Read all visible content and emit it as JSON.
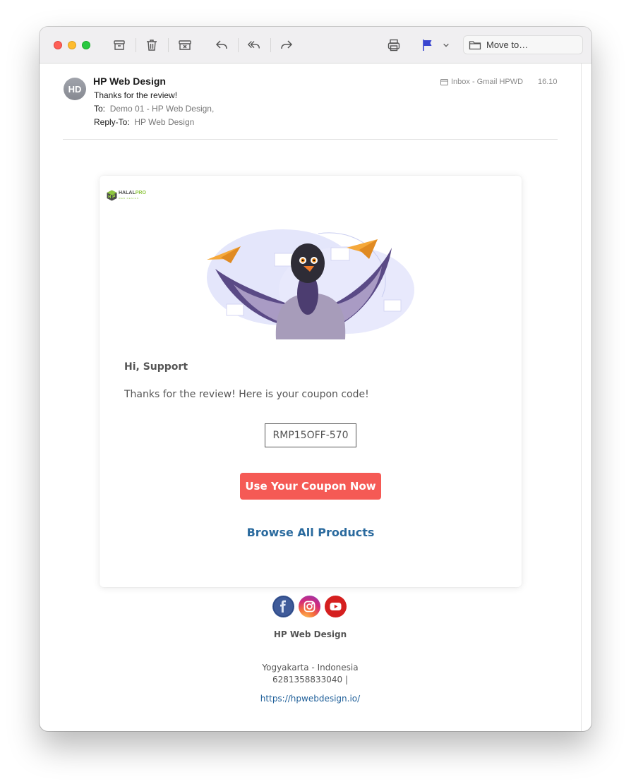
{
  "toolbar": {
    "move_to_label": "Move to…",
    "icons": [
      "archive-icon",
      "trash-icon",
      "junk-icon",
      "reply-icon",
      "reply-all-icon",
      "forward-icon",
      "print-icon",
      "flag-icon",
      "chevron-down-icon",
      "folder-icon"
    ],
    "flag_color": "#3a46d0"
  },
  "message": {
    "avatar_initials": "HD",
    "from": "HP Web Design",
    "subject": "Thanks for the review!",
    "to_label": "To:",
    "to_value": "Demo 01 - HP Web Design,",
    "reply_to_label": "Reply-To:",
    "reply_to_value": "HP Web Design",
    "mailbox": "Inbox - Gmail HPWD",
    "time": "16.10"
  },
  "email": {
    "logo_part1": "HALAL",
    "logo_part2": "PRO",
    "logo_sub": "WEB DESIGN",
    "greeting": "Hi,  Support",
    "body": "Thanks for the review! Here is your coupon code!",
    "coupon_code": "RMP15OFF-570",
    "cta_label": "Use Your Coupon Now",
    "cta_color": "#f55a55",
    "browse_label": "Browse All Products",
    "link_color": "#2a6a9e"
  },
  "footer": {
    "social_icons": [
      "facebook-icon",
      "instagram-icon",
      "youtube-icon"
    ],
    "company": "HP Web Design",
    "address": "Yogyakarta - Indonesia",
    "phone": "6281358833040 |",
    "url": "https://hpwebdesign.io/"
  }
}
